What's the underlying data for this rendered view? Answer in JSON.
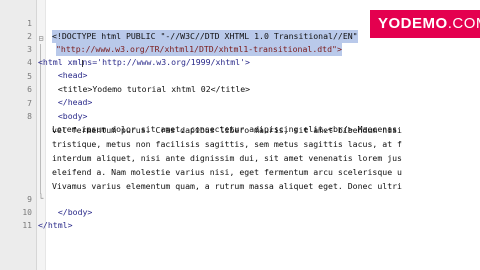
{
  "logo": {
    "brand": "YODEMO",
    "tld": ".COM"
  },
  "lines": [
    {
      "n": "1",
      "code": "<!DOCTYPE html PUBLIC \"-//W3C//DTD XHTML 1.0 Transitional//EN\""
    },
    {
      "n": "2",
      "code": "\"http://www.w3.org/TR/xhtml1/DTD/xhtml1-transitional.dtd\">"
    },
    {
      "n": "3",
      "code": "<html xmlns='http://www.w3.org/1999/xhtml'>"
    },
    {
      "n": "4",
      "code": "  <head>"
    },
    {
      "n": "5",
      "code": "  <title>Yodemo tutorial xhtml 02</title>"
    },
    {
      "n": "6",
      "code": "  </head>"
    },
    {
      "n": "7",
      "code": "  <body>"
    },
    {
      "n": "8",
      "code": "Lorem ipsum dolor sit amet, consectetur adipiscing elit.<br/> Maecenas"
    },
    {
      "n": "",
      "code": "vel fermentum purus. Cras dapibus libero mauris, sit amet bibendum nisi"
    },
    {
      "n": "",
      "code": "tristique, metus non facilisis sagittis, sem metus sagittis lacus, at f"
    },
    {
      "n": "",
      "code": "interdum aliquet, nisi ante dignissim dui, sit amet venenatis lorem jus"
    },
    {
      "n": "",
      "code": "eleifend a. Nam molestie varius nisi, eget fermentum arcu scelerisque u"
    },
    {
      "n": "",
      "code": "Vivamus varius elementum quam, a rutrum massa aliquet eget. Donec ultri"
    },
    {
      "n": "9",
      "code": "  </body>"
    },
    {
      "n": "10",
      "code": "</html>"
    },
    {
      "n": "11",
      "code": ""
    }
  ]
}
